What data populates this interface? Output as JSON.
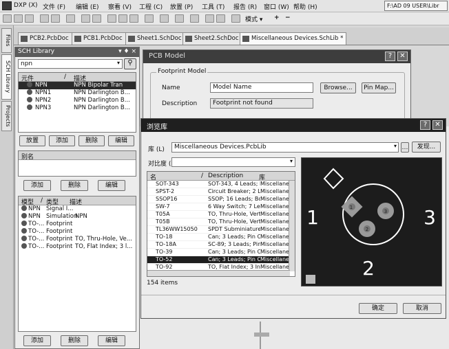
{
  "menubar": {
    "items": [
      "DXP (X)",
      "文件 (F)",
      "编辑 (E)",
      "察看 (V)",
      "工程 (C)",
      "放置 (P)",
      "工具 (T)",
      "报告 (R)",
      "窗口 (W)",
      "帮助 (H)"
    ],
    "path": "F:\\AD 09 USER\\Libr"
  },
  "toolbar": {
    "mode_label": "模式 ▾",
    "plus": "+",
    "minus": "−"
  },
  "side_tabs": [
    "Files",
    "SCH Library",
    "Projects"
  ],
  "doc_tabs": [
    "PCB2.PcbDoc",
    "PCB1.PcbDoc",
    "Sheet1.SchDoc *",
    "Sheet2.SchDoc *",
    "Miscellaneous Devices.SchLib *"
  ],
  "schlib": {
    "title": "SCH Library",
    "title_buttons": "▾ ♦ ×",
    "search_value": "npn",
    "comp_headers": [
      "元件",
      "/",
      "描述"
    ],
    "components": [
      {
        "name": "NPN",
        "desc": "NPN Bipolar Tran",
        "selected": true
      },
      {
        "name": "NPN1",
        "desc": "NPN Darlington B...",
        "selected": false
      },
      {
        "name": "NPN2",
        "desc": "NPN Darlington B...",
        "selected": false
      },
      {
        "name": "NPN3",
        "desc": "NPN Darlington B...",
        "selected": false
      }
    ],
    "buttons1": [
      "放置",
      "添加",
      "删除",
      "编辑"
    ],
    "alias_header": "别名",
    "buttons2": [
      "添加",
      "删除",
      "编辑"
    ],
    "model_headers": [
      "模型",
      "/",
      "类型",
      "描述"
    ],
    "models": [
      {
        "name": "NPN",
        "type": "Signal I...",
        "desc": ""
      },
      {
        "name": "NPN",
        "type": "Simulation",
        "desc": "NPN"
      },
      {
        "name": "TO-...",
        "type": "Footprint",
        "desc": ""
      },
      {
        "name": "TO-...",
        "type": "Footprint",
        "desc": ""
      },
      {
        "name": "TO-...",
        "type": "Footprint",
        "desc": "TO, Thru-Hole, Ve..."
      },
      {
        "name": "TO-...",
        "type": "Footprint",
        "desc": "TO, Flat Index; 3 l..."
      }
    ],
    "buttons3": [
      "添加",
      "删除",
      "编辑"
    ]
  },
  "pcb_model": {
    "title": "PCB Model",
    "group": "Footprint Model",
    "name_label": "Name",
    "name_value": "Model Name",
    "browse_button": "Browse...",
    "pinmap_button": "Pin Map...",
    "desc_label": "Description",
    "desc_value": "Footprint not found",
    "help": "?",
    "close": "✕"
  },
  "browse": {
    "title": "浏览库",
    "lib_label": "库 (L)",
    "lib_value": "Miscellaneous Devices.PcbLib",
    "find_button": "发现...",
    "mask_label": "对比度 (",
    "columns": [
      "名",
      "/",
      "Description",
      "库"
    ],
    "rows": [
      {
        "name": "SOT-343",
        "desc": "SOT-343, 4 Leads; E",
        "lib": "Miscellaneo",
        "selected": false
      },
      {
        "name": "SPST-2",
        "desc": "Circuit Breaker; 2 Le",
        "lib": "Miscellaneo",
        "selected": false
      },
      {
        "name": "SSOP16",
        "desc": "SSOP; 16 Leads; Bo",
        "lib": "Miscellaneo",
        "selected": false
      },
      {
        "name": "SW-7",
        "desc": "6 Way Switch; 7 Le",
        "lib": "Miscellaneo",
        "selected": false
      },
      {
        "name": "T05A",
        "desc": "TO, Thru-Hole, Vertk",
        "lib": "Miscellaneo",
        "selected": false
      },
      {
        "name": "T05B",
        "desc": "TO, Thru-Hole, Vertk",
        "lib": "Miscellaneo",
        "selected": false
      },
      {
        "name": "TL36WW15050",
        "desc": "SPDT Subminiature",
        "lib": "Miscellaneo",
        "selected": false
      },
      {
        "name": "TO-18",
        "desc": "Can; 3 Leads; Pin Ci",
        "lib": "Miscellaneo",
        "selected": false
      },
      {
        "name": "TO-18A",
        "desc": "SC-89; 3 Leads; Pin",
        "lib": "Miscellaneo",
        "selected": false
      },
      {
        "name": "TO-39",
        "desc": "Can; 3 Leads; Pin Ci",
        "lib": "Miscellaneo",
        "selected": false
      },
      {
        "name": "TO-52",
        "desc": "Can; 3 Leads; Pin Ci",
        "lib": "Miscellaneo",
        "selected": true
      },
      {
        "name": "TO-92",
        "desc": "TO, Flat Index; 3 In-I",
        "lib": "Miscellaneo",
        "selected": false
      }
    ],
    "count": "154 items",
    "preview_labels": [
      "1",
      "2",
      "3"
    ],
    "pin_numbers": [
      "1",
      "2",
      "3"
    ],
    "ok": "确定",
    "cancel": "取消"
  },
  "colors": {
    "pcb_bg": "#1c1c1c",
    "pad": "#9a9a9a",
    "silk": "#ffffff"
  }
}
